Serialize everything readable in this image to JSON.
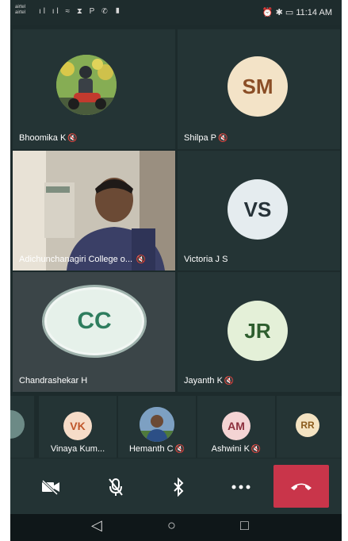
{
  "status_bar": {
    "carrier_1": "airtel",
    "carrier_2": "airtel",
    "left_icons": "ıl ıl ≈ ⧗ P ✆ ▮",
    "right_icons": "⏰ ✱ ▭",
    "time": "11:14 AM"
  },
  "participants": [
    {
      "name": "Bhoomika K",
      "muted": true,
      "type": "photo"
    },
    {
      "name": "Shilpa P",
      "muted": true,
      "type": "avatar",
      "initials": "SM",
      "bg": "#f3e3c7",
      "fg": "#8a4e26"
    },
    {
      "name": "Adichunchanagiri College o...",
      "muted": true,
      "type": "video"
    },
    {
      "name": "Victoria J S",
      "muted": false,
      "type": "avatar",
      "initials": "VS",
      "bg": "#e5ecef",
      "fg": "#263238"
    },
    {
      "name": "Chandrashekar H",
      "muted": false,
      "type": "avatar",
      "initials": "CC",
      "bg": "#e6f1ea",
      "fg": "#2e7d5e",
      "active": true
    },
    {
      "name": "Jayanth K",
      "muted": true,
      "type": "avatar",
      "initials": "JR",
      "bg": "#e4f0d8",
      "fg": "#2e5e2e"
    }
  ],
  "strip": [
    {
      "name": "Vinaya Kum...",
      "initials": "VK",
      "bg": "#f6dcc8",
      "fg": "#c0562a",
      "muted": false
    },
    {
      "name": "Hemanth C",
      "type": "photo",
      "muted": true
    },
    {
      "name": "Ashwini K",
      "initials": "AM",
      "bg": "#f4d4d4",
      "fg": "#8c2f3c",
      "muted": true
    },
    {
      "name": "",
      "initials": "RR",
      "bg": "#f4e3c2",
      "fg": "#8a5a1c",
      "muted": false
    }
  ],
  "mute_glyph": "🔇",
  "controls": {
    "camera_off": "camera-off",
    "mic_off": "mic-off",
    "bluetooth": "bluetooth",
    "more": "more",
    "hangup": "end-call"
  },
  "nav": {
    "back": "◁",
    "home": "○",
    "recents": "□"
  },
  "colors": {
    "background": "#1d2b2c",
    "tile": "#243435",
    "active_tile": "#3b4548",
    "hangup": "#c9354a"
  }
}
